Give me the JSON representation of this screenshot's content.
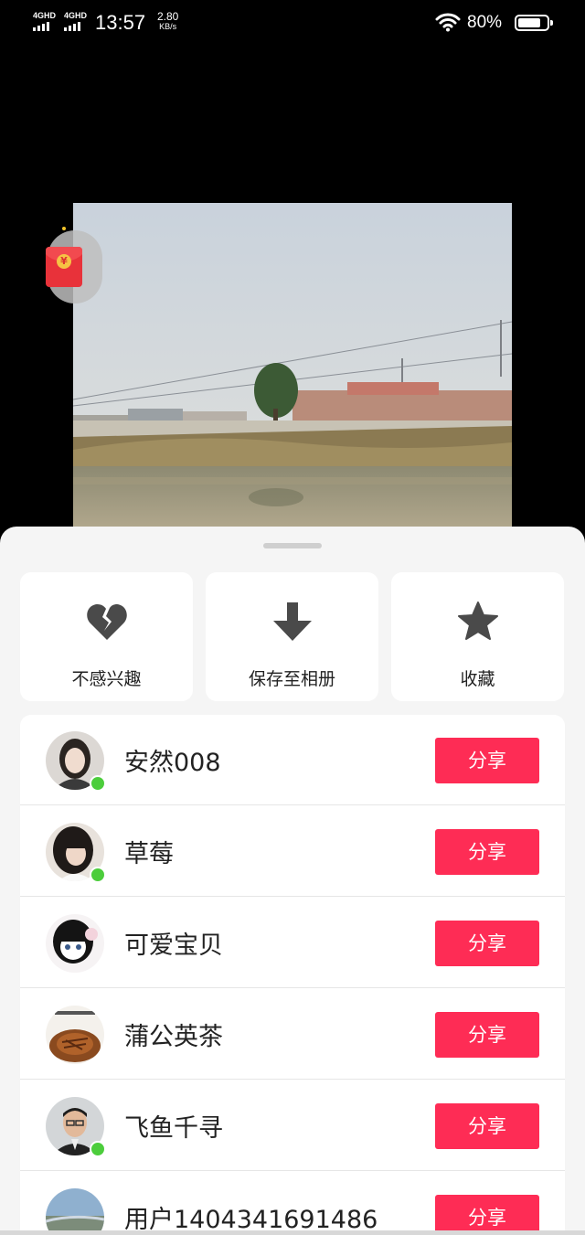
{
  "status_bar": {
    "net1": "4GHD",
    "net2": "4GHD",
    "time": "13:57",
    "speed_value": "2.80",
    "speed_unit": "KB/s",
    "battery": "80%",
    "battery_level": 0.8,
    "icons": [
      "signal-icon",
      "wifi-icon",
      "battery-icon"
    ]
  },
  "floating": {
    "icon": "red-envelope-icon",
    "coin_symbol": "¥"
  },
  "actions": [
    {
      "label": "不感兴趣",
      "icon": "broken-heart-icon"
    },
    {
      "label": "保存至相册",
      "icon": "download-icon"
    },
    {
      "label": "收藏",
      "icon": "star-icon"
    }
  ],
  "friends": [
    {
      "name": "安然008",
      "online": true,
      "share_label": "分享"
    },
    {
      "name": "草莓",
      "online": true,
      "share_label": "分享"
    },
    {
      "name": "可爱宝贝",
      "online": false,
      "share_label": "分享"
    },
    {
      "name": "蒲公英茶",
      "online": false,
      "share_label": "分享"
    },
    {
      "name": "飞鱼千寻",
      "online": true,
      "share_label": "分享"
    },
    {
      "name": "用户1404341691486",
      "online": false,
      "share_label": "分享"
    }
  ],
  "colors": {
    "share_button": "#fe2c55",
    "online_dot": "#4ccd3c",
    "icon_gray": "#4a4a4a",
    "sheet_bg": "#f5f5f5"
  }
}
